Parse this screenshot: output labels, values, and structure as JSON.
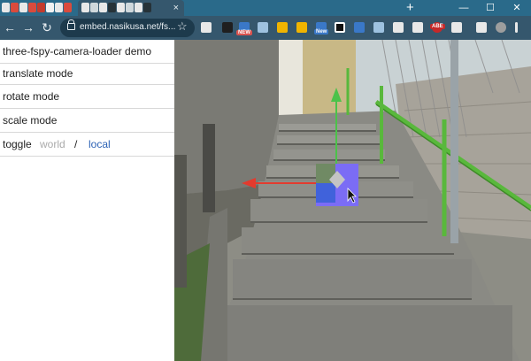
{
  "browser": {
    "tab_close": "×",
    "new_tab": "+",
    "controls": {
      "minimize": "—",
      "maximize": "☐",
      "close": "✕"
    },
    "toolbar": {
      "back": "←",
      "forward": "→",
      "reload": "↻",
      "star": "☆"
    },
    "url": "embed.nasikusa.net/fs...",
    "badges": {
      "new1": "NEW",
      "new2": "New",
      "ext": "ABE"
    },
    "colors": {
      "tabstrip": "#2a6a8a",
      "toolbar": "#35576d",
      "omnibox": "#1d3a4c"
    }
  },
  "panel": {
    "items": [
      {
        "label": "three-fspy-camera-loader demo"
      },
      {
        "label": "translate mode"
      },
      {
        "label": "rotate mode"
      },
      {
        "label": "scale mode"
      }
    ],
    "toggle": {
      "label": "toggle",
      "world": "world",
      "slash": "/",
      "local": "local"
    }
  },
  "viewport": {
    "object_color": "#7b6cf5",
    "gizmo_colors": {
      "x": "#e33b2e",
      "y": "#4cc24a"
    },
    "rail_color": "#59b83c"
  }
}
